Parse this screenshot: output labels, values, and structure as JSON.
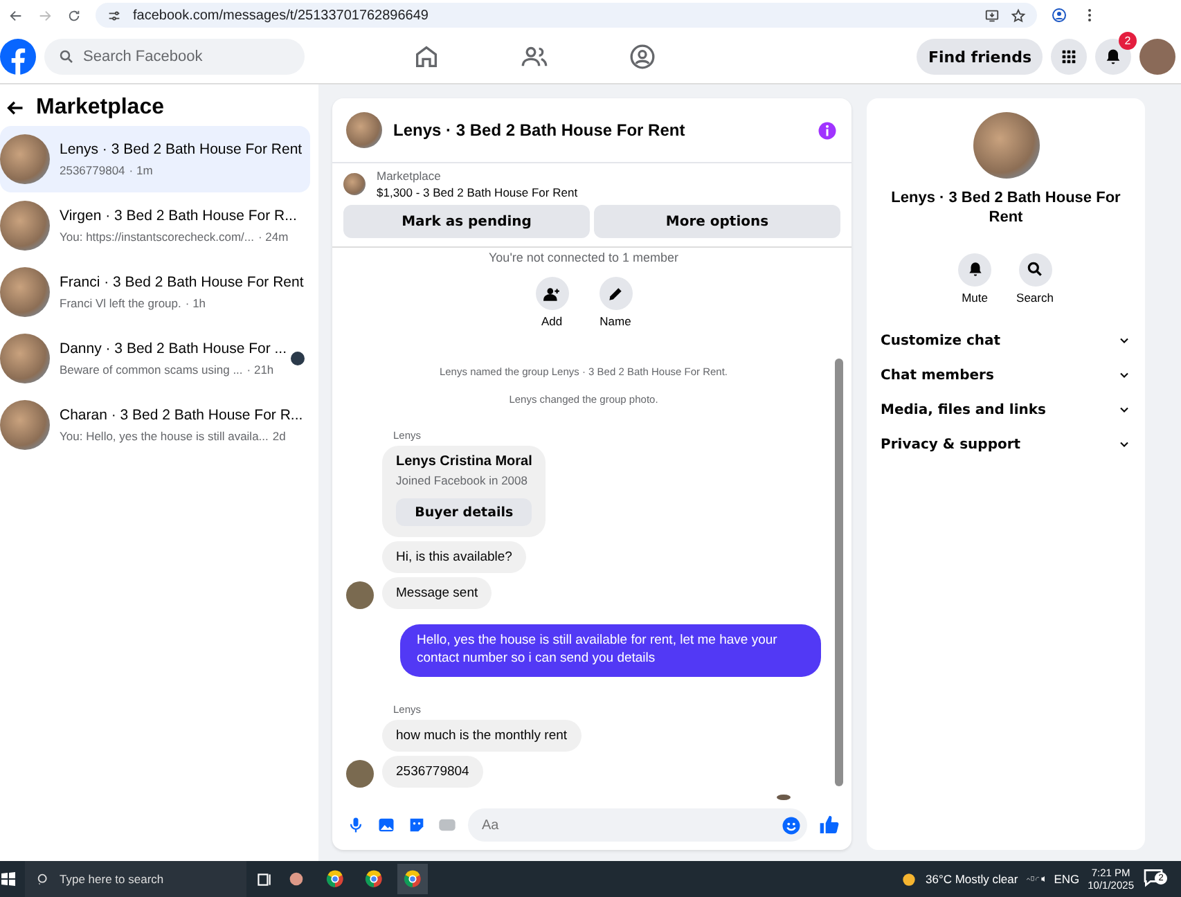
{
  "browser": {
    "url": "facebook.com/messages/t/25133701762896649"
  },
  "header": {
    "search_placeholder": "Search Facebook",
    "find_friends": "Find friends",
    "notification_count": "2"
  },
  "sidebar": {
    "title": "Marketplace",
    "conversations": [
      {
        "title": "Lenys · 3 Bed 2 Bath House For Rent",
        "preview": "2536779804",
        "time": "· 1m",
        "selected": true,
        "seen_avatar": false
      },
      {
        "title": "Virgen · 3 Bed 2 Bath House For R...",
        "preview": "You: https://instantscorecheck.com/...",
        "time": "· 24m",
        "selected": false,
        "seen_avatar": false
      },
      {
        "title": "Franci · 3 Bed 2 Bath House For Rent",
        "preview": "Franci Vl left the group.",
        "time": "· 1h",
        "selected": false,
        "seen_avatar": false
      },
      {
        "title": "Danny · 3 Bed 2 Bath House For ...",
        "preview": "Beware of common scams using ...",
        "time": "· 21h",
        "selected": false,
        "seen_avatar": true
      },
      {
        "title": "Charan · 3 Bed 2 Bath House For R...",
        "preview": "You: Hello, yes the house is still availa...",
        "time": "2d",
        "selected": false,
        "seen_avatar": false
      }
    ]
  },
  "chat": {
    "title": "Lenys · 3 Bed 2 Bath House For Rent",
    "listing": {
      "label": "Marketplace",
      "price_title": "$1,300 - 3 Bed 2 Bath House For Rent",
      "buttons": [
        "Mark as pending",
        "More options"
      ]
    },
    "notice": "You're not connected to 1 member",
    "actions": [
      "Add",
      "Name"
    ],
    "messages": [
      {
        "kind": "system",
        "text": "Lenys named the group Lenys · 3 Bed 2 Bath House For Rent."
      },
      {
        "kind": "system",
        "text": "Lenys changed the group photo."
      },
      {
        "kind": "sender",
        "text": "Lenys"
      },
      {
        "kind": "profile",
        "name": "Lenys Cristina Moral",
        "detail": "Joined Facebook in 2008",
        "button": "Buyer details"
      },
      {
        "kind": "incoming",
        "text": "Hi, is this available?",
        "avatar": false
      },
      {
        "kind": "incoming",
        "text": "Message sent",
        "avatar": true
      },
      {
        "kind": "outgoing",
        "text": "Hello, yes the house is still available for rent, let me have your contact number so i can send you  details"
      },
      {
        "kind": "sender",
        "text": "Lenys"
      },
      {
        "kind": "incoming",
        "text": "how much is the monthly rent",
        "avatar": false
      },
      {
        "kind": "incoming",
        "text": "2536779804",
        "avatar": true
      }
    ],
    "composer_placeholder": "Aa"
  },
  "details": {
    "title": "Lenys · 3 Bed 2 Bath House For Rent",
    "actions": [
      "Mute",
      "Search"
    ],
    "sections": [
      {
        "label": "Customize chat",
        "expanded": false
      },
      {
        "label": "Chat members",
        "expanded": false
      },
      {
        "label": "Media, files and links",
        "expanded": false
      },
      {
        "label": "Privacy & support",
        "expanded": false
      }
    ]
  },
  "taskbar": {
    "search_placeholder": "Type here to search",
    "weather": "36°C  Mostly clear",
    "language": "ENG",
    "time": "7:21 PM",
    "date": "10/1/2025",
    "notification_count": "2"
  }
}
